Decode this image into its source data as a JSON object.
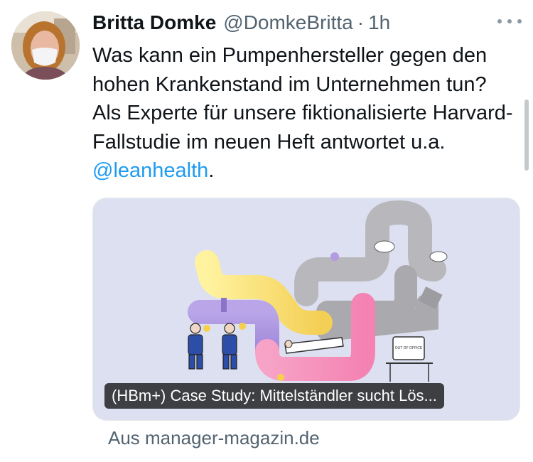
{
  "tweet": {
    "author_name": "Britta Domke",
    "handle": "@DomkeBritta",
    "separator": "·",
    "time": "1h",
    "text_before_mention": "Was kann ein Pumpenhersteller gegen den hohen Krankenstand im Unternehmen tun? Als Experte für unsere fiktionalisierte Harvard-Fallstudie im neuen Heft antwortet u.a. ",
    "mention": "@leanhealth",
    "text_after_mention": ".",
    "more_icon": "more-horizontal-icon"
  },
  "card": {
    "title": "(HBm+) Case Study: Mittelständler sucht Lös...",
    "source": "Aus manager-magazin.de",
    "illustration_text": "OUT OF OFFICE"
  },
  "colors": {
    "text": "#0f1419",
    "secondary": "#536471",
    "link": "#1d9bf0",
    "card_background": "#dde0f0"
  }
}
